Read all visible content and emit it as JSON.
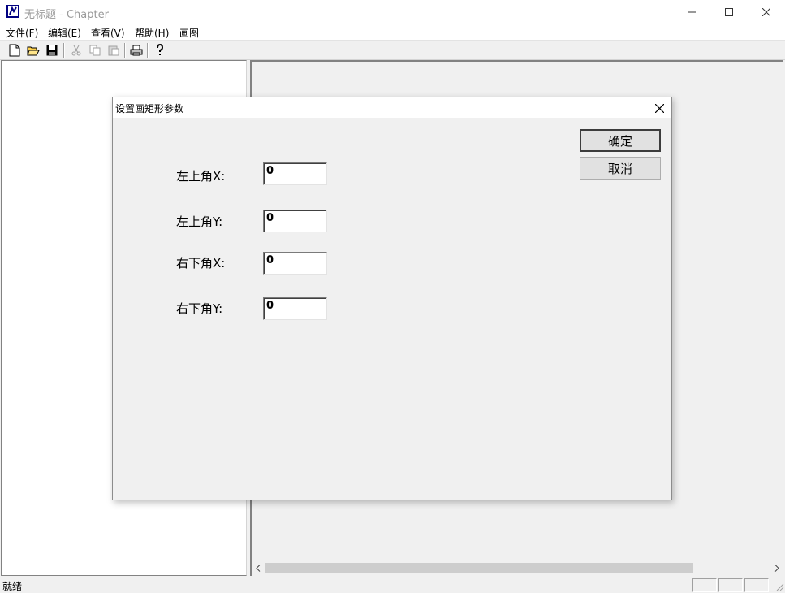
{
  "window": {
    "title": "无标题 - Chapter"
  },
  "menu": {
    "items": [
      {
        "label": "文件(F)"
      },
      {
        "label": "编辑(E)"
      },
      {
        "label": "查看(V)"
      },
      {
        "label": "帮助(H)"
      },
      {
        "label": "画图"
      }
    ]
  },
  "toolbar": {
    "buttons": [
      "new-file-icon",
      "open-folder-icon",
      "save-icon",
      "cut-icon",
      "copy-icon",
      "paste-icon",
      "print-icon",
      "help-icon"
    ]
  },
  "dialog": {
    "title": "设置画矩形参数",
    "fields": [
      {
        "label": "左上角X:",
        "value": "0"
      },
      {
        "label": "左上角Y:",
        "value": "0"
      },
      {
        "label": "右下角X:",
        "value": "0"
      },
      {
        "label": "右下角Y:",
        "value": "0"
      }
    ],
    "ok_label": "确定",
    "cancel_label": "取消"
  },
  "statusbar": {
    "text": "就绪"
  }
}
